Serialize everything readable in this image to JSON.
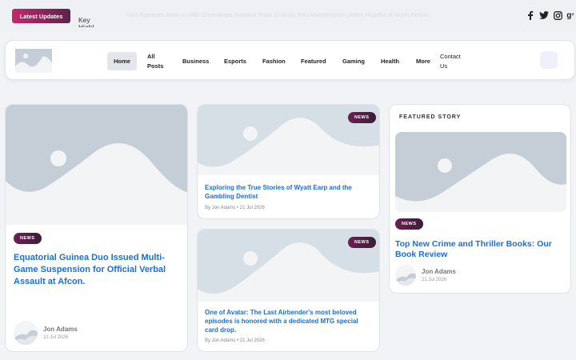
{
  "topbar": {
    "latest_label": "Latest Updates",
    "key_label": "Key Highlights",
    "ticker_text": "Hart Releases Birds in Wild Greenlanda National Team Crosses Red Maintenance United Hopeful of North Return",
    "social": [
      {
        "icon": "facebook-icon",
        "glyph": "f"
      },
      {
        "icon": "twitter-icon",
        "glyph": "🐦"
      },
      {
        "icon": "instagram-icon",
        "glyph": "◎"
      },
      {
        "icon": "google-plus-icon",
        "glyph": "g+"
      }
    ]
  },
  "nav": {
    "items": [
      "Home",
      "All Posts",
      "Business",
      "Esports",
      "Fashion",
      "Featured",
      "Gaming",
      "Health",
      "More",
      "Contact Us"
    ],
    "active": "Home"
  },
  "cards": [
    {
      "badge": "NEWS",
      "title": "Equatorial Guinea Duo Issued Multi-Game Suspension for Official Verbal Assault at Afcon.",
      "author": "Jon Adams",
      "date": "22 Jul 2026"
    },
    {
      "badge": "NEWS",
      "title": "Exploring the True Stories of Wyatt Earp and the Gambling Dentist",
      "meta": "By Jon Adams  • 21 Jul 2026"
    },
    {
      "badge": "NEWS",
      "title": "One of Avatar: The Last Airbender's most beloved episodes is honored with a dedicated MTG special card drop.",
      "meta": "By Jon Adams  • 21 Jul 2026"
    }
  ],
  "featured": {
    "label": "FEATURED STORY",
    "badge": "NEWS",
    "title": "Top New Crime and Thriller Books: Our Book Review",
    "author": "Jon Adams",
    "date": "21 Jul 2026"
  },
  "colors": {
    "accent": "#1a6fd6",
    "badge_start": "#c4296e",
    "badge_end": "#5a2348",
    "placeholder": "#c5cdd6"
  }
}
